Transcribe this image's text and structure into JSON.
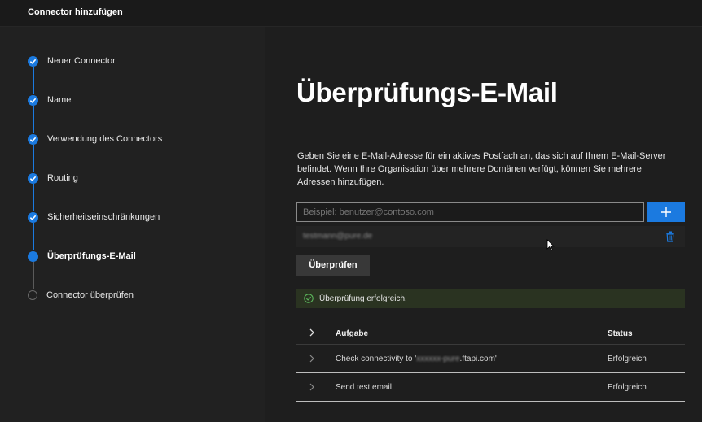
{
  "window": {
    "title": "Connector hinzufügen"
  },
  "steps": [
    {
      "label": "Neuer Connector",
      "state": "done"
    },
    {
      "label": "Name",
      "state": "done"
    },
    {
      "label": "Verwendung des Connectors",
      "state": "done"
    },
    {
      "label": "Routing",
      "state": "done"
    },
    {
      "label": "Sicherheitseinschränkungen",
      "state": "done"
    },
    {
      "label": "Überprüfungs-E-Mail",
      "state": "current"
    },
    {
      "label": "Connector überprüfen",
      "state": "pending"
    }
  ],
  "main": {
    "heading": "Überprüfungs-E-Mail",
    "description": "Geben Sie eine E-Mail-Adresse für ein aktives Postfach an, das sich auf Ihrem E-Mail-Server befindet. Wenn Ihre Organisation über mehrere Domänen verfügt, können Sie mehrere Adressen hinzufügen.",
    "email_placeholder": "Beispiel: benutzer@contoso.com",
    "email_value": "",
    "added_email": "testmann@pure.de",
    "verify_button": "Überprüfen",
    "success_message": "Überprüfung erfolgreich."
  },
  "table": {
    "headers": {
      "task": "Aufgabe",
      "status": "Status"
    },
    "rows": [
      {
        "task_prefix": "Check connectivity to '",
        "task_masked": "xxxxxx-pure",
        "task_suffix": ".ftapi.com'",
        "status": "Erfolgreich"
      },
      {
        "task": "Send test email",
        "status": "Erfolgreich"
      }
    ]
  },
  "colors": {
    "accent": "#1b7ae0",
    "success_bg": "#2a3321",
    "success_icon": "#5bb55b"
  },
  "icons": [
    "checkmark-icon",
    "plus-icon",
    "trash-icon",
    "success-check-icon",
    "chevron-right-icon",
    "mouse-cursor-icon"
  ]
}
